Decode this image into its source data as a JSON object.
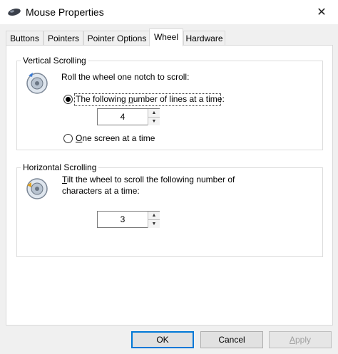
{
  "window": {
    "title": "Mouse Properties",
    "close_glyph": "✕"
  },
  "tabs": [
    {
      "label": "Buttons"
    },
    {
      "label": "Pointers"
    },
    {
      "label": "Pointer Options"
    },
    {
      "label": "Wheel",
      "active": true
    },
    {
      "label": "Hardware"
    }
  ],
  "vertical": {
    "group_label": "Vertical Scrolling",
    "prompt": "Roll the wheel one notch to scroll:",
    "option_lines": {
      "prefix": "The following ",
      "accel": "n",
      "suffix": "umber of lines at a time:",
      "selected": true
    },
    "lines_value": "4",
    "option_screen": {
      "accel": "O",
      "suffix": "ne screen at a time",
      "selected": false
    }
  },
  "horizontal": {
    "group_label": "Horizontal Scrolling",
    "prompt_line1_accel": "T",
    "prompt_line1_rest": "ilt the wheel to scroll the following number of",
    "prompt_line2": "characters at a time:",
    "chars_value": "3"
  },
  "buttons": {
    "ok": "OK",
    "cancel": "Cancel",
    "apply_accel": "A",
    "apply_rest": "pply"
  },
  "colors": {
    "accent": "#0078d7",
    "panel_bg": "#ffffff",
    "dialog_bg": "#f0f0f0"
  },
  "icons": {
    "app": "mouse-icon",
    "wheel": "scroll-wheel-icon"
  }
}
